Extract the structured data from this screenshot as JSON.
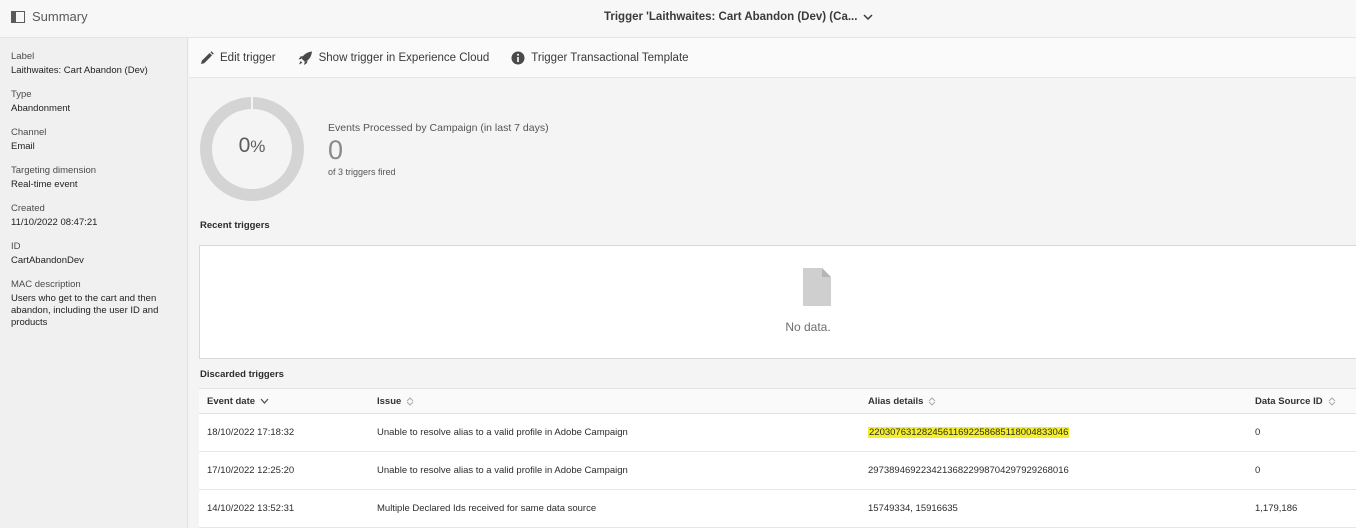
{
  "topbar": {
    "summary_label": "Summary",
    "trigger_title": "Trigger 'Laithwaites: Cart Abandon (Dev) (Ca..."
  },
  "details": [
    {
      "label": "Label",
      "value": "Laithwaites: Cart Abandon (Dev)"
    },
    {
      "label": "Type",
      "value": "Abandonment"
    },
    {
      "label": "Channel",
      "value": "Email"
    },
    {
      "label": "Targeting dimension",
      "value": "Real-time event"
    },
    {
      "label": "Created",
      "value": "11/10/2022 08:47:21"
    },
    {
      "label": "ID",
      "value": "CartAbandonDev"
    },
    {
      "label": "MAC description",
      "value": "Users who get to the cart and then abandon, including the user ID and products"
    }
  ],
  "actions": {
    "edit": "Edit trigger",
    "show": "Show trigger in Experience Cloud",
    "template": "Trigger Transactional Template"
  },
  "stats": {
    "percent_value": "0",
    "percent_sign": "%",
    "progress_fraction": 0,
    "events_label": "Events Processed by Campaign (in last 7 days)",
    "events_count": "0",
    "events_sub": "of 3 triggers fired"
  },
  "recent": {
    "title": "Recent triggers",
    "empty_text": "No data."
  },
  "discarded": {
    "title": "Discarded triggers",
    "columns": [
      "Event date",
      "Issue",
      "Alias details",
      "Data Source ID"
    ],
    "rows": [
      {
        "date": "18/10/2022 17:18:32",
        "issue": "Unable to resolve alias to a valid profile in Adobe Campaign",
        "alias": "22030763128245611692258685118004833046",
        "source": "0"
      },
      {
        "date": "17/10/2022 12:25:20",
        "issue": "Unable to resolve alias to a valid profile in Adobe Campaign",
        "alias": "29738946922342136822998704297929268016",
        "source": "0"
      },
      {
        "date": "14/10/2022 13:52:31",
        "issue": "Multiple Declared Ids received for same data source",
        "alias": "15749334, 15916635",
        "source": "1,179,186"
      }
    ]
  },
  "colors": {
    "highlight": "#f5ef2a",
    "donut_track": "#d4d4d4"
  }
}
